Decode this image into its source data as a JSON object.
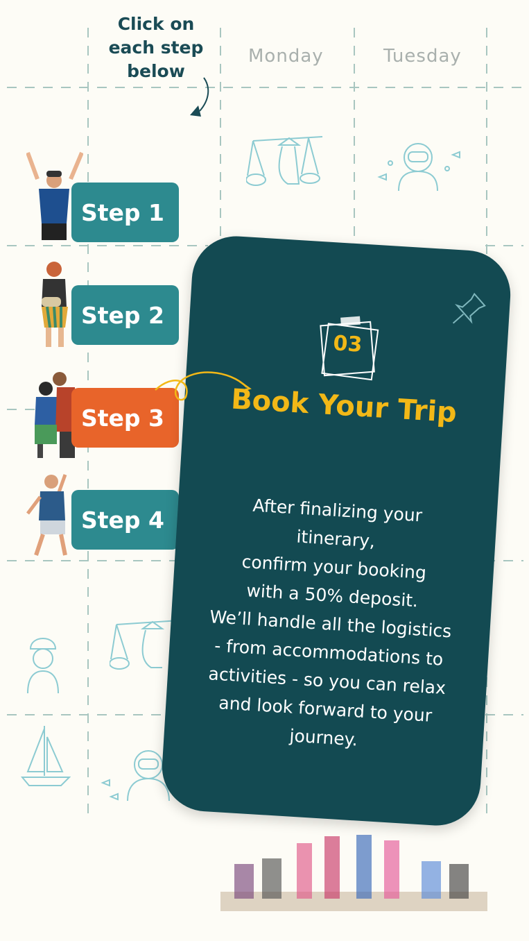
{
  "hint": {
    "text": "Click on\neach step\nbelow"
  },
  "days": [
    "Monday",
    "Tuesday"
  ],
  "steps": [
    {
      "label": "Step 1",
      "active": false
    },
    {
      "label": "Step 2",
      "active": false
    },
    {
      "label": "Step 3",
      "active": true
    },
    {
      "label": "Step 4",
      "active": false
    }
  ],
  "card": {
    "number": "03",
    "title": "Book Your Trip",
    "body": "After finalizing your\nitinerary,\nconfirm your booking\nwith a 50% deposit.\nWe’ll handle all the logistics\n- from accommodations to\nactivities - so you can relax\nand look forward to your\njourney."
  },
  "colors": {
    "step_default": "#2d8a8f",
    "step_active": "#e8642a",
    "card_bg": "#134a52",
    "accent_yellow": "#f2b817",
    "hint_text": "#1a4b55"
  },
  "icons": [
    "arrow-down-icon",
    "curly-arrow-icon",
    "pushpin-icon",
    "sticky-note-icon"
  ]
}
